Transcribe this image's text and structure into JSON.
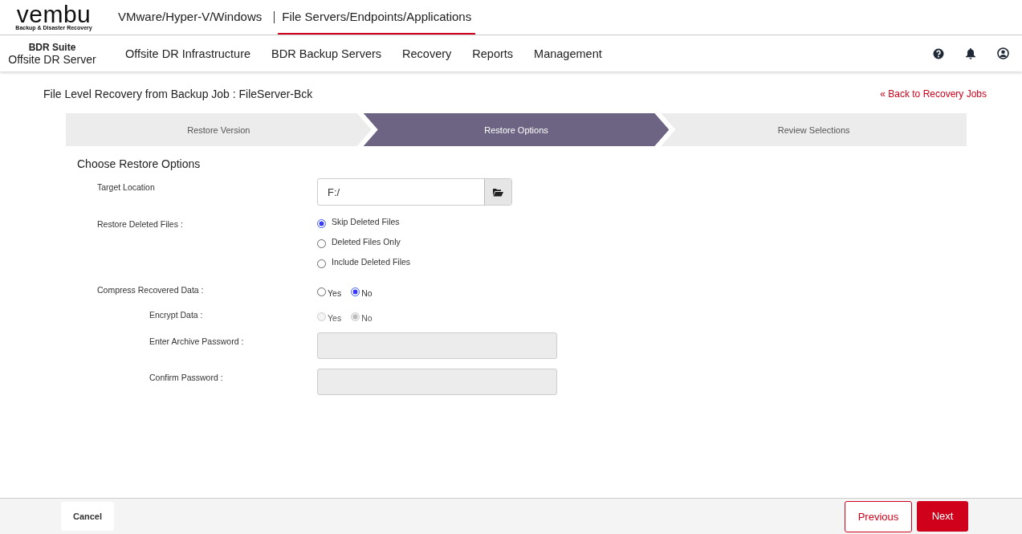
{
  "logo": {
    "name": "vembu",
    "tagline": "Backup & Disaster Recovery"
  },
  "product_tabs": [
    {
      "label": "VMware/Hyper-V/Windows",
      "selected": false
    },
    {
      "label": "File Servers/Endpoints/Applications",
      "selected": true
    }
  ],
  "product": {
    "suite": "BDR Suite",
    "server": "Offsite DR Server"
  },
  "nav": [
    {
      "label": "Offsite DR Infrastructure"
    },
    {
      "label": "BDR Backup Servers"
    },
    {
      "label": "Recovery"
    },
    {
      "label": "Reports"
    },
    {
      "label": "Management"
    }
  ],
  "page_title": "File Level Recovery from Backup Job : FileServer-Bck",
  "back_link": "« Back to Recovery Jobs",
  "steps": [
    {
      "label": "Restore Version",
      "selected": false
    },
    {
      "label": "Restore Options",
      "selected": true
    },
    {
      "label": "Review Selections",
      "selected": false
    }
  ],
  "section_title": "Choose Restore Options",
  "target_location": {
    "label": "Target Location",
    "value": "F:/"
  },
  "restore_deleted": {
    "label": "Restore Deleted Files :",
    "options": [
      {
        "label": "Skip Deleted Files",
        "selected": true
      },
      {
        "label": "Deleted Files Only",
        "selected": false
      },
      {
        "label": "Include Deleted Files",
        "selected": false
      }
    ]
  },
  "compress": {
    "label": "Compress Recovered Data :",
    "disabled": false,
    "options": [
      {
        "label": "Yes",
        "selected": false
      },
      {
        "label": "No",
        "selected": true
      }
    ]
  },
  "encrypt": {
    "label": "Encrypt Data :",
    "disabled": true,
    "options": [
      {
        "label": "Yes",
        "selected": false
      },
      {
        "label": "No",
        "selected": true
      }
    ]
  },
  "password_fields": [
    {
      "label": "Enter Archive Password :",
      "disabled": true
    },
    {
      "label": "Confirm Password :",
      "disabled": true
    }
  ],
  "footer": {
    "cancel": "Cancel",
    "previous": "Previous",
    "next": "Next"
  }
}
